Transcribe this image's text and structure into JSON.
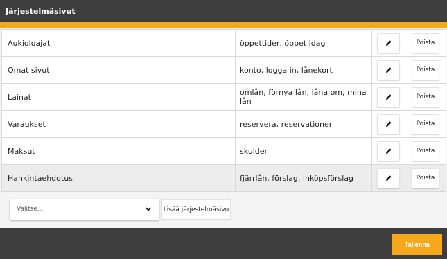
{
  "window": {
    "title": "Järjestelmäsivut"
  },
  "colors": {
    "accent": "#f5a81c",
    "frame": "#3d3d3d"
  },
  "rows": [
    {
      "name": "Aukioloajat",
      "keywords": "öppettider, öppet idag",
      "delete_label": "Poista",
      "edit_icon": "pencil-icon"
    },
    {
      "name": "Omat sivut",
      "keywords": "konto, logga in, lånekort",
      "delete_label": "Poista",
      "edit_icon": "pencil-icon"
    },
    {
      "name": "Lainat",
      "keywords": "omlån, förnya lån, låna om, mina lån",
      "delete_label": "Poista",
      "edit_icon": "pencil-icon"
    },
    {
      "name": "Varaukset",
      "keywords": "reservera, reservationer",
      "delete_label": "Poista",
      "edit_icon": "pencil-icon"
    },
    {
      "name": "Maksut",
      "keywords": "skulder",
      "delete_label": "Poista",
      "edit_icon": "pencil-icon"
    },
    {
      "name": "Hankintaehdotus",
      "keywords": "fjärrlån, förslag, inköpsförslag",
      "delete_label": "Poista",
      "edit_icon": "pencil-icon",
      "highlighted": true
    }
  ],
  "add_form": {
    "select_value": "Valitse...",
    "select_icon": "chevron-down-icon",
    "add_label": "Lisää järjestelmäsivu"
  },
  "footer": {
    "save_label": "Tallenna"
  }
}
